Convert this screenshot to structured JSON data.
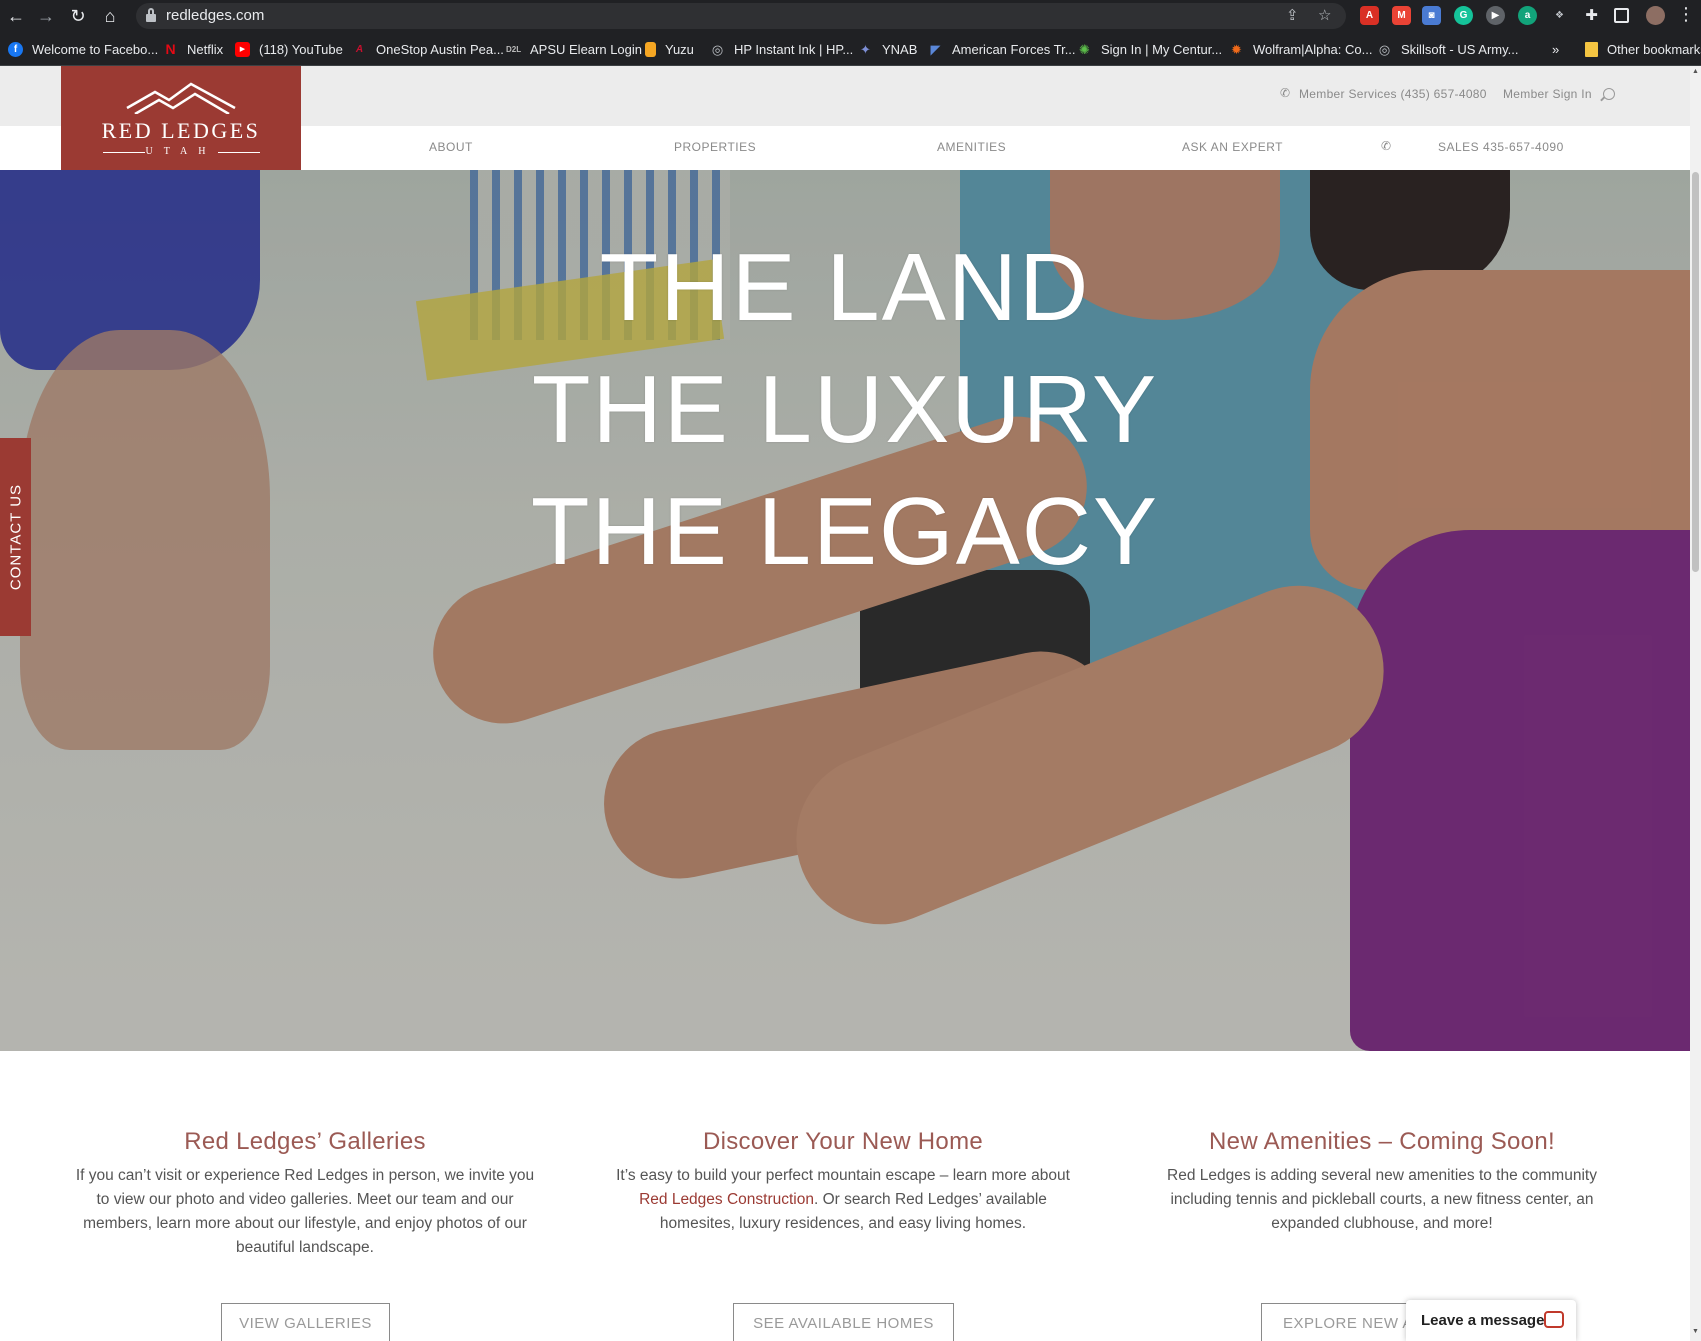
{
  "browser": {
    "url": "redledges.com",
    "bookmarks": [
      {
        "label": "Welcome to Facebo...",
        "icon": "facebook-icon",
        "color": "#1877f2",
        "glyph": "f"
      },
      {
        "label": "Netflix",
        "icon": "netflix-icon",
        "color": "#e50914",
        "glyph": "N"
      },
      {
        "label": "(118) YouTube",
        "icon": "youtube-icon",
        "color": "#ff0000",
        "glyph": "▶"
      },
      {
        "label": "OneStop Austin Pea...",
        "icon": "apsu-icon",
        "color": "#c8102e",
        "glyph": "A"
      },
      {
        "label": "APSU Elearn Login",
        "icon": "d2l-icon",
        "color": "#555555",
        "glyph": "D"
      },
      {
        "label": "Yuzu",
        "icon": "yuzu-icon",
        "color": "#f5a623",
        "glyph": "Y"
      },
      {
        "label": "HP Instant Ink | HP...",
        "icon": "globe-icon",
        "color": "#5f6368",
        "glyph": "◎"
      },
      {
        "label": "YNAB",
        "icon": "ynab-icon",
        "color": "#4e5ea8",
        "glyph": "✦"
      },
      {
        "label": "American Forces Tr...",
        "icon": "aft-icon",
        "color": "#2656a8",
        "glyph": "◤"
      },
      {
        "label": "Sign In | My Centur...",
        "icon": "century-icon",
        "color": "#3f9b3c",
        "glyph": "✺"
      },
      {
        "label": "Wolfram|Alpha: Co...",
        "icon": "wolfram-icon",
        "color": "#dd5500",
        "glyph": "✹"
      },
      {
        "label": "Skillsoft - US Army...",
        "icon": "globe-icon",
        "color": "#5f6368",
        "glyph": "◎"
      },
      {
        "label": "Other bookmarks",
        "icon": "folder-icon",
        "color": "#f4c542",
        "glyph": ""
      }
    ],
    "overflow": "»"
  },
  "site": {
    "logo": {
      "name": "RED LEDGES",
      "sub": "UTAH"
    },
    "top_links": {
      "member_services": "Member Services (435) 657-4080",
      "sign_in": "Member Sign In"
    },
    "nav": [
      {
        "label": "ABOUT"
      },
      {
        "label": "PROPERTIES"
      },
      {
        "label": "AMENITIES"
      },
      {
        "label": "ASK AN EXPERT"
      },
      {
        "label": "SALES 435-657-4090"
      }
    ],
    "hero": {
      "line1": "THE LAND",
      "line2": "THE LUXURY",
      "line3": "THE LEGACY"
    },
    "contact_tab": "CONTACT US",
    "columns": [
      {
        "title": "Red Ledges’ Galleries",
        "body": "If you can’t visit or experience Red Ledges in person, we invite you to view our photo and video galleries. Meet our team and our members, learn more about our lifestyle, and enjoy photos of our beautiful landscape.",
        "cta": "VIEW GALLERIES"
      },
      {
        "title": "Discover Your New Home",
        "body_before": "It’s easy to build your perfect mountain escape – learn more about ",
        "body_link": "Red Ledges Construction",
        "body_after": ". Or search Red Ledges’ available homesites, luxury residences, and easy living homes.",
        "cta": "SEE AVAILABLE HOMES"
      },
      {
        "title": "New Amenities – Coming Soon!",
        "body": "Red Ledges is adding several new amenities to the community including tennis and pickleball courts, a new fitness center, an expanded clubhouse, and more!",
        "cta": "EXPLORE NEW A"
      }
    ],
    "chat": "Leave a message",
    "colors": {
      "brand": "#9b3a33",
      "heading": "#9b5a54"
    }
  }
}
